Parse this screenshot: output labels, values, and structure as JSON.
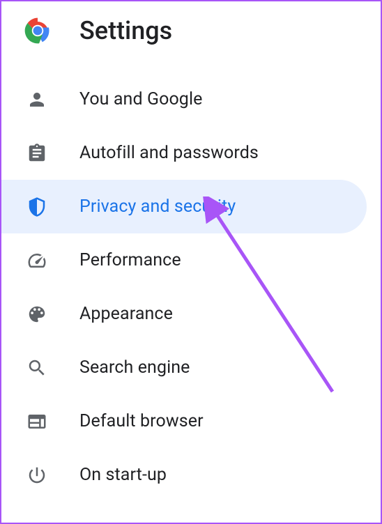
{
  "header": {
    "title": "Settings"
  },
  "nav": {
    "items": [
      {
        "id": "you-and-google",
        "label": "You and Google",
        "icon": "person-icon",
        "active": false
      },
      {
        "id": "autofill",
        "label": "Autofill and passwords",
        "icon": "clipboard-icon",
        "active": false
      },
      {
        "id": "privacy",
        "label": "Privacy and security",
        "icon": "shield-icon",
        "active": true
      },
      {
        "id": "performance",
        "label": "Performance",
        "icon": "speedometer-icon",
        "active": false
      },
      {
        "id": "appearance",
        "label": "Appearance",
        "icon": "palette-icon",
        "active": false
      },
      {
        "id": "search-engine",
        "label": "Search engine",
        "icon": "search-icon",
        "active": false
      },
      {
        "id": "default-browser",
        "label": "Default browser",
        "icon": "browser-icon",
        "active": false
      },
      {
        "id": "startup",
        "label": "On start-up",
        "icon": "power-icon",
        "active": false
      }
    ]
  },
  "annotation": {
    "arrow_color": "#a855f7"
  }
}
